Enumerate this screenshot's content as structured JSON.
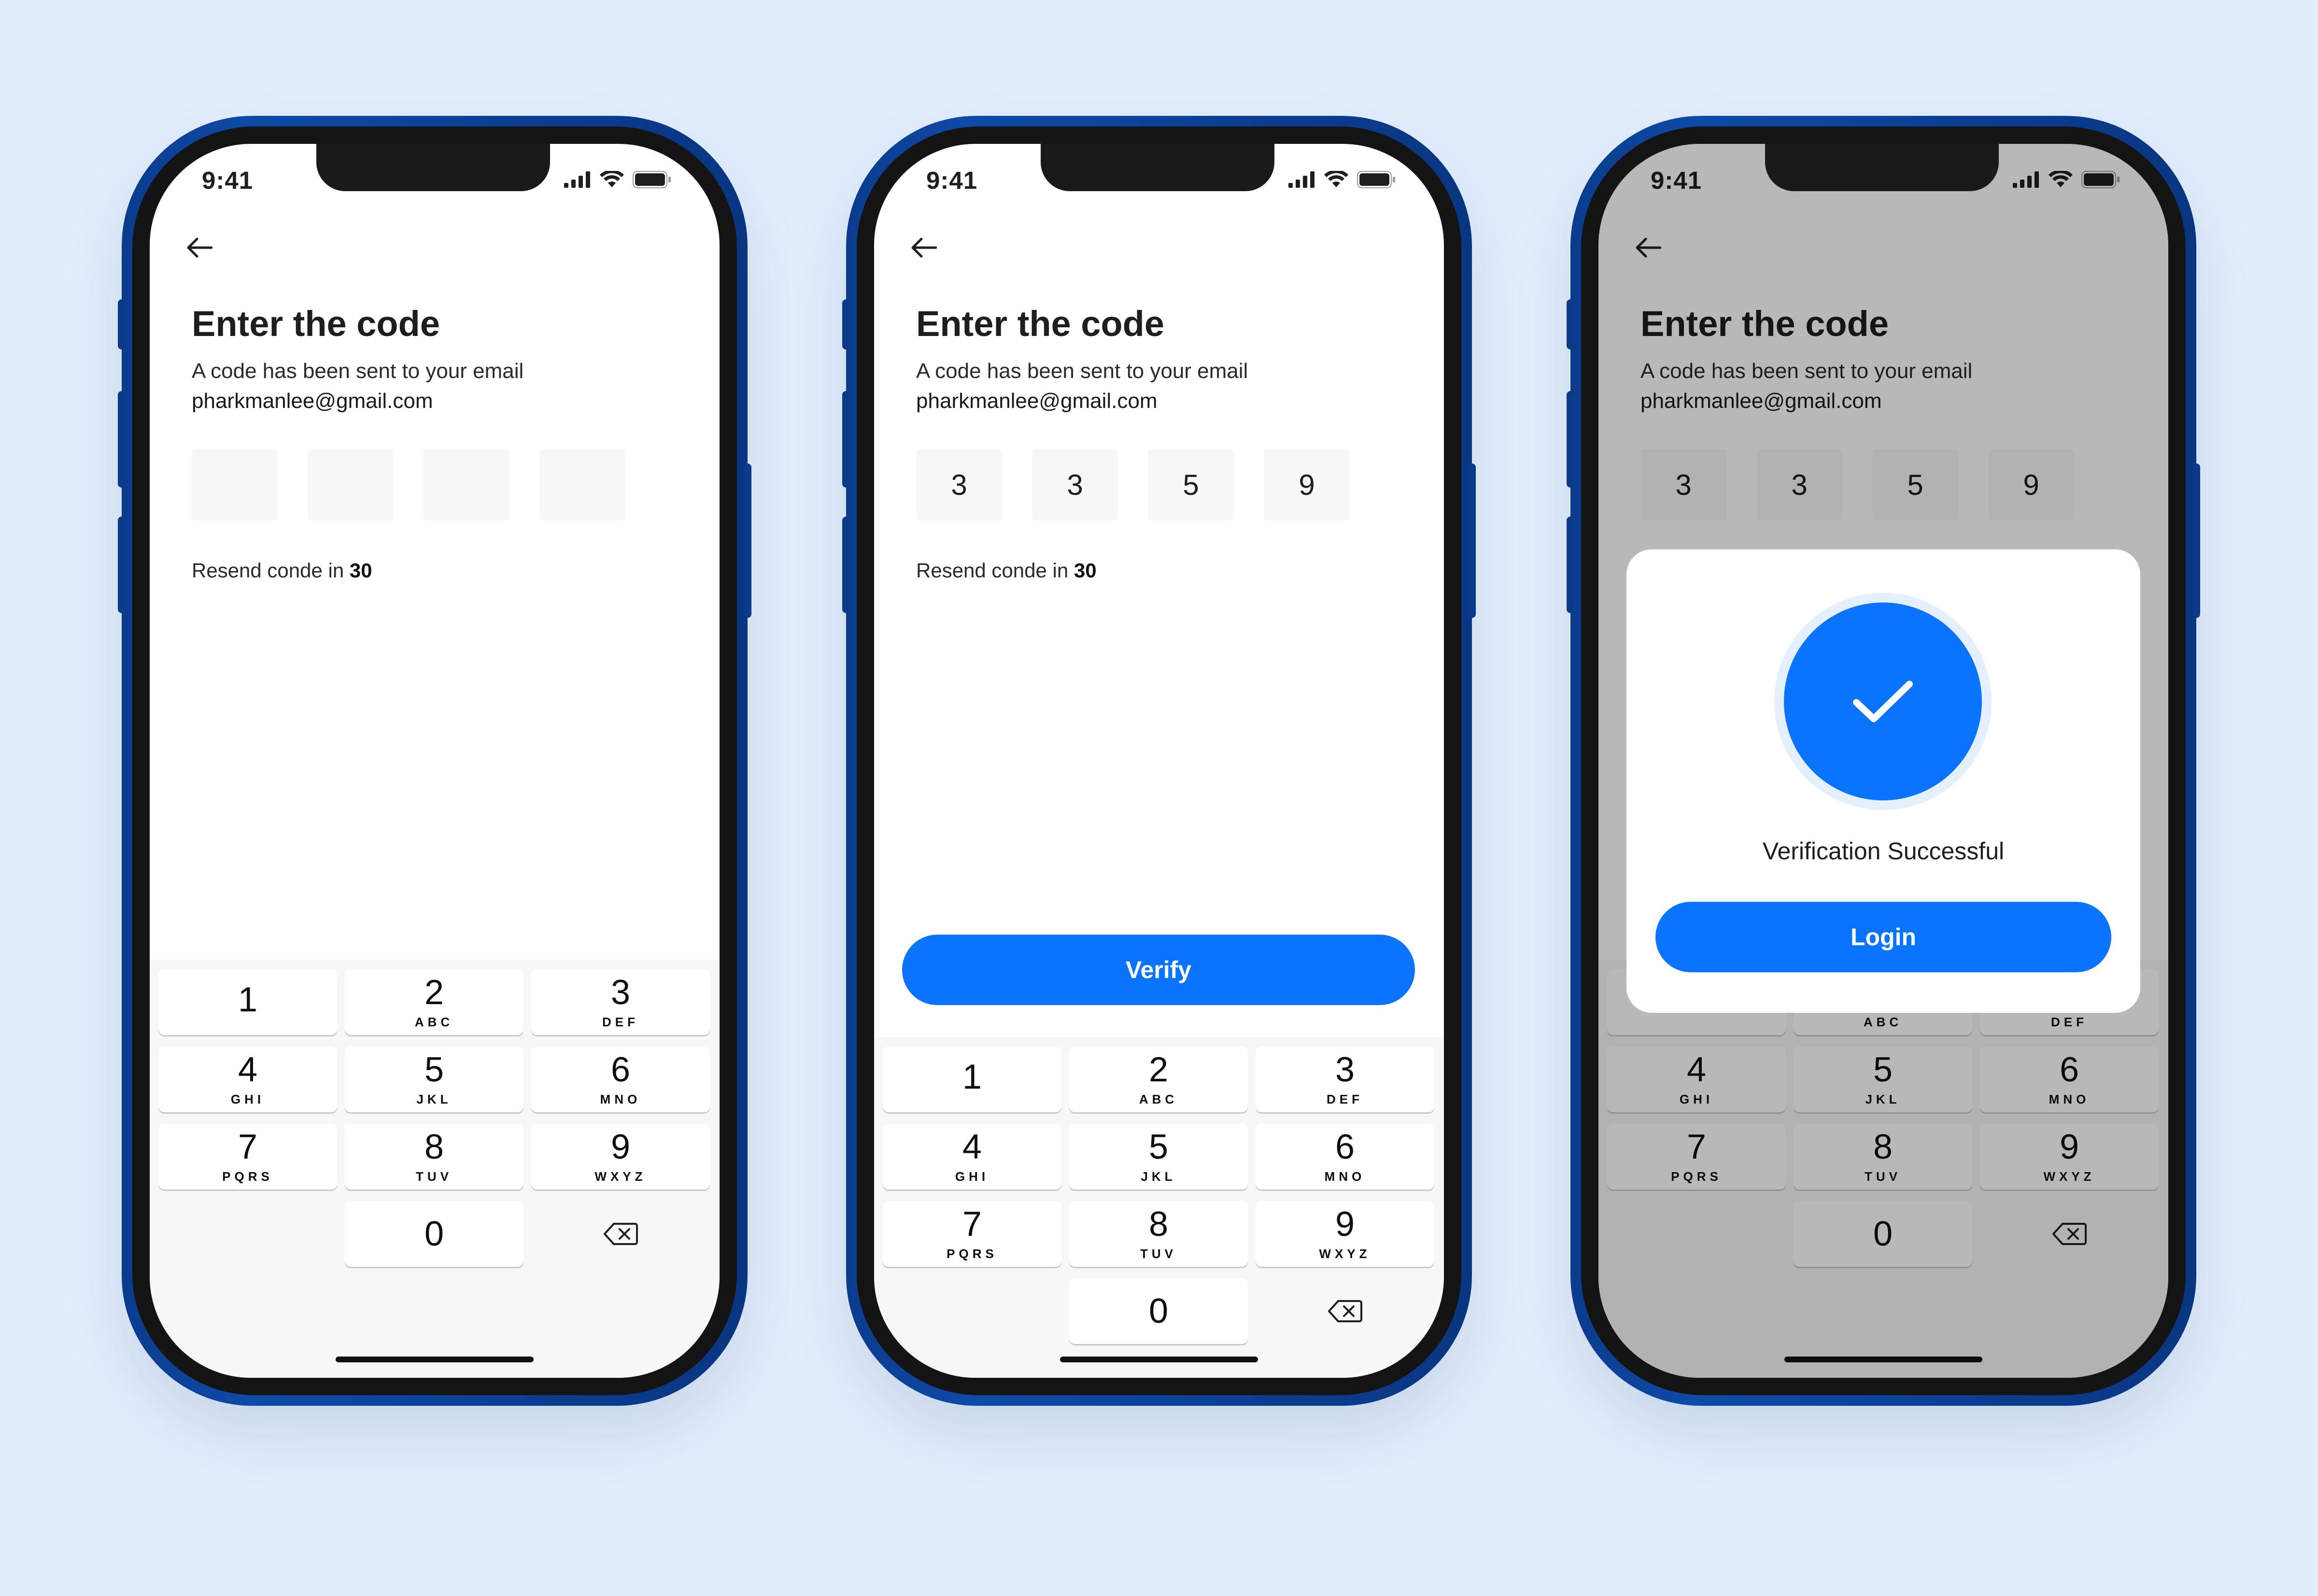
{
  "colors": {
    "background": "#e2eefc",
    "accent": "#0a74ff",
    "frame": "#0f4aa8"
  },
  "status": {
    "time": "9:41"
  },
  "screen": {
    "title": "Enter the code",
    "subtitle": "A code has been sent to your email",
    "email": "pharkmanlee@gmail.com",
    "resend_prefix": "Resend conde in ",
    "resend_count": "30"
  },
  "phones": [
    {
      "code": [
        "",
        "",
        "",
        ""
      ]
    },
    {
      "code": [
        "3",
        "3",
        "5",
        "9"
      ],
      "verify_label": "Verify"
    },
    {
      "code": [
        "3",
        "3",
        "5",
        "9"
      ],
      "modal_message": "Verification Successful",
      "login_label": "Login"
    }
  ],
  "keypad": [
    {
      "digit": "1",
      "letters": ""
    },
    {
      "digit": "2",
      "letters": "ABC"
    },
    {
      "digit": "3",
      "letters": "DEF"
    },
    {
      "digit": "4",
      "letters": "GHI"
    },
    {
      "digit": "5",
      "letters": "JKL"
    },
    {
      "digit": "6",
      "letters": "MNO"
    },
    {
      "digit": "7",
      "letters": "PQRS"
    },
    {
      "digit": "8",
      "letters": "TUV"
    },
    {
      "digit": "9",
      "letters": "WXYZ"
    },
    {
      "digit": "0",
      "letters": ""
    }
  ],
  "icons": {
    "back": "back-arrow-icon",
    "signal": "cellular-signal-icon",
    "wifi": "wifi-icon",
    "battery": "battery-icon",
    "delete": "backspace-icon",
    "success": "checkmark-icon"
  }
}
